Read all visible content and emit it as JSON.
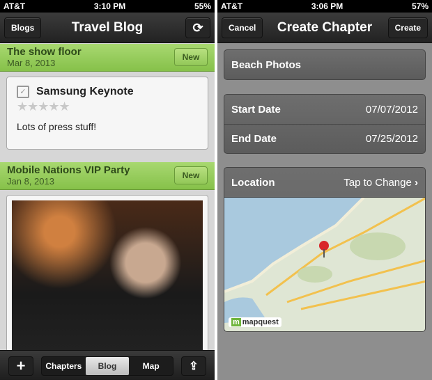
{
  "left": {
    "status": {
      "carrier": "AT&T",
      "time": "3:10 PM",
      "battery": "55%"
    },
    "nav": {
      "back": "Blogs",
      "title": "Travel Blog",
      "refresh_icon": "refresh-icon"
    },
    "entries": [
      {
        "title": "The show floor",
        "date": "Mar 8, 2013",
        "badge": "New",
        "card_title": "Samsung Keynote",
        "rating": 0,
        "rating_max": 5,
        "body": "Lots of press stuff!"
      },
      {
        "title": "Mobile Nations VIP Party",
        "date": "Jan 8, 2013",
        "badge": "New"
      }
    ],
    "toolbar": {
      "segments": [
        "Chapters",
        "Blog",
        "Map"
      ],
      "selected": "Blog"
    }
  },
  "right": {
    "status": {
      "carrier": "AT&T",
      "time": "3:06 PM",
      "battery": "57%"
    },
    "nav": {
      "cancel": "Cancel",
      "title": "Create Chapter",
      "create": "Create"
    },
    "name": "Beach Photos",
    "start_label": "Start Date",
    "start_value": "07/07/2012",
    "end_label": "End Date",
    "end_value": "07/25/2012",
    "location_label": "Location",
    "location_value": "Tap to Change",
    "map_logo": "mapquest"
  },
  "colors": {
    "accent_green": "#8cc552",
    "nav_dark": "#2a2a2a"
  }
}
